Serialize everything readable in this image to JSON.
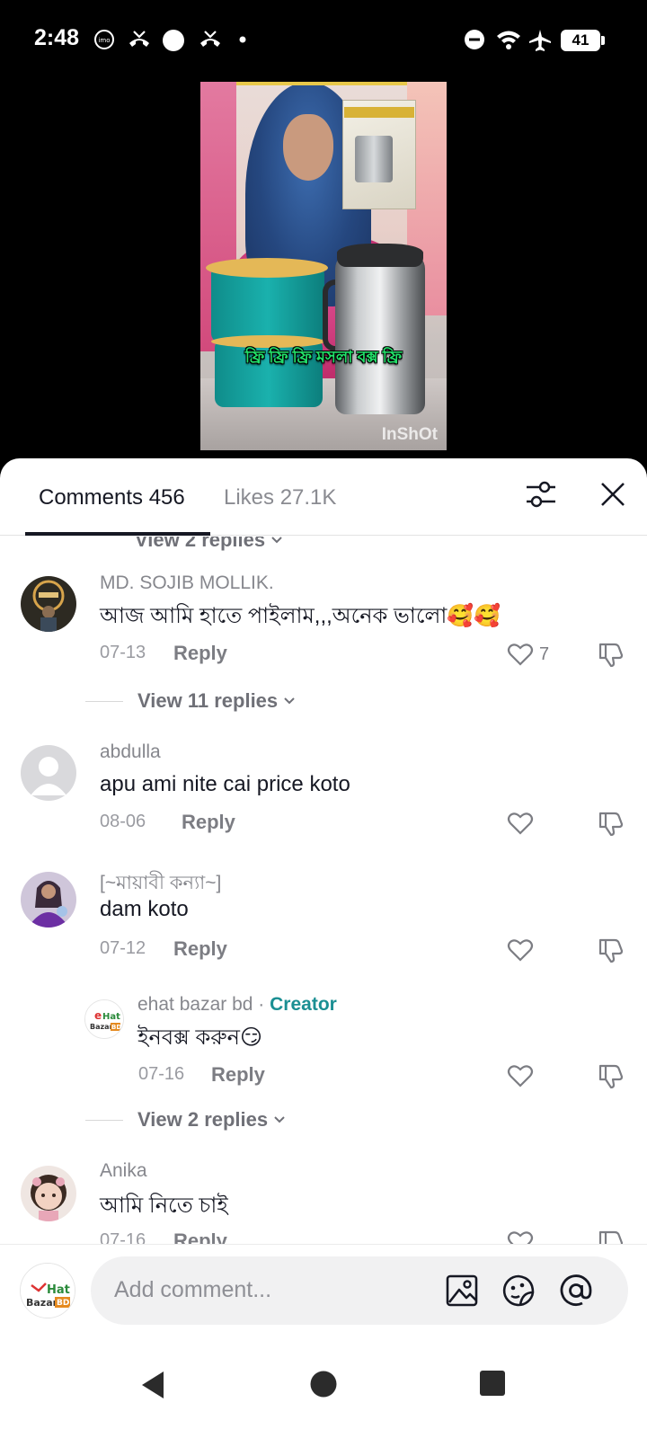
{
  "status_bar": {
    "time": "2:48",
    "battery": "41",
    "left_icons": [
      "imo-icon",
      "missed-call-icon",
      "circle-icon",
      "missed-call-icon",
      "dot-icon"
    ],
    "right_icons": [
      "dnd-icon",
      "wifi-icon",
      "airplane-icon",
      "battery-icon"
    ]
  },
  "video": {
    "caption": "ফ্রি ফ্রি ফ্রি মসলা বক্স ফ্রি",
    "watermark": "InShOt"
  },
  "sheet": {
    "tab_comments": "Comments 456",
    "tab_likes": "Likes 27.1K",
    "top_replies_label": "View 2 replies"
  },
  "comments": [
    {
      "username": "MD. SOJIB MOLLIK.",
      "text": "আজ আমি হাতে পাইলাম,,,অনেক ভালো🥰🥰",
      "date": "07-13",
      "reply_label": "Reply",
      "likes": "7",
      "view_replies": "View 11 replies"
    },
    {
      "username": "abdulla",
      "text": "apu ami nite cai price koto",
      "date": "08-06",
      "reply_label": "Reply"
    },
    {
      "username": "[~মায়াবী কন্যা~]",
      "text": "dam koto",
      "date": "07-12",
      "reply_label": "Reply"
    },
    {
      "username": "ehat bazar bd",
      "badge": "Creator",
      "separator": "·",
      "text": "ইনবক্স করুন😏",
      "date": "07-16",
      "reply_label": "Reply",
      "view_replies": "View 2 replies"
    },
    {
      "username": "Anika",
      "text": "আমি নিতে চাই",
      "date": "07-16",
      "reply_label": "Reply"
    }
  ],
  "logo": {
    "line1": "Hat",
    "line2": "Bazar",
    "badge": "BD"
  },
  "input": {
    "placeholder": "Add comment..."
  },
  "colors": {
    "accent_creator": "#1b8f93",
    "text_primary": "#161823",
    "text_secondary": "#86878d"
  }
}
